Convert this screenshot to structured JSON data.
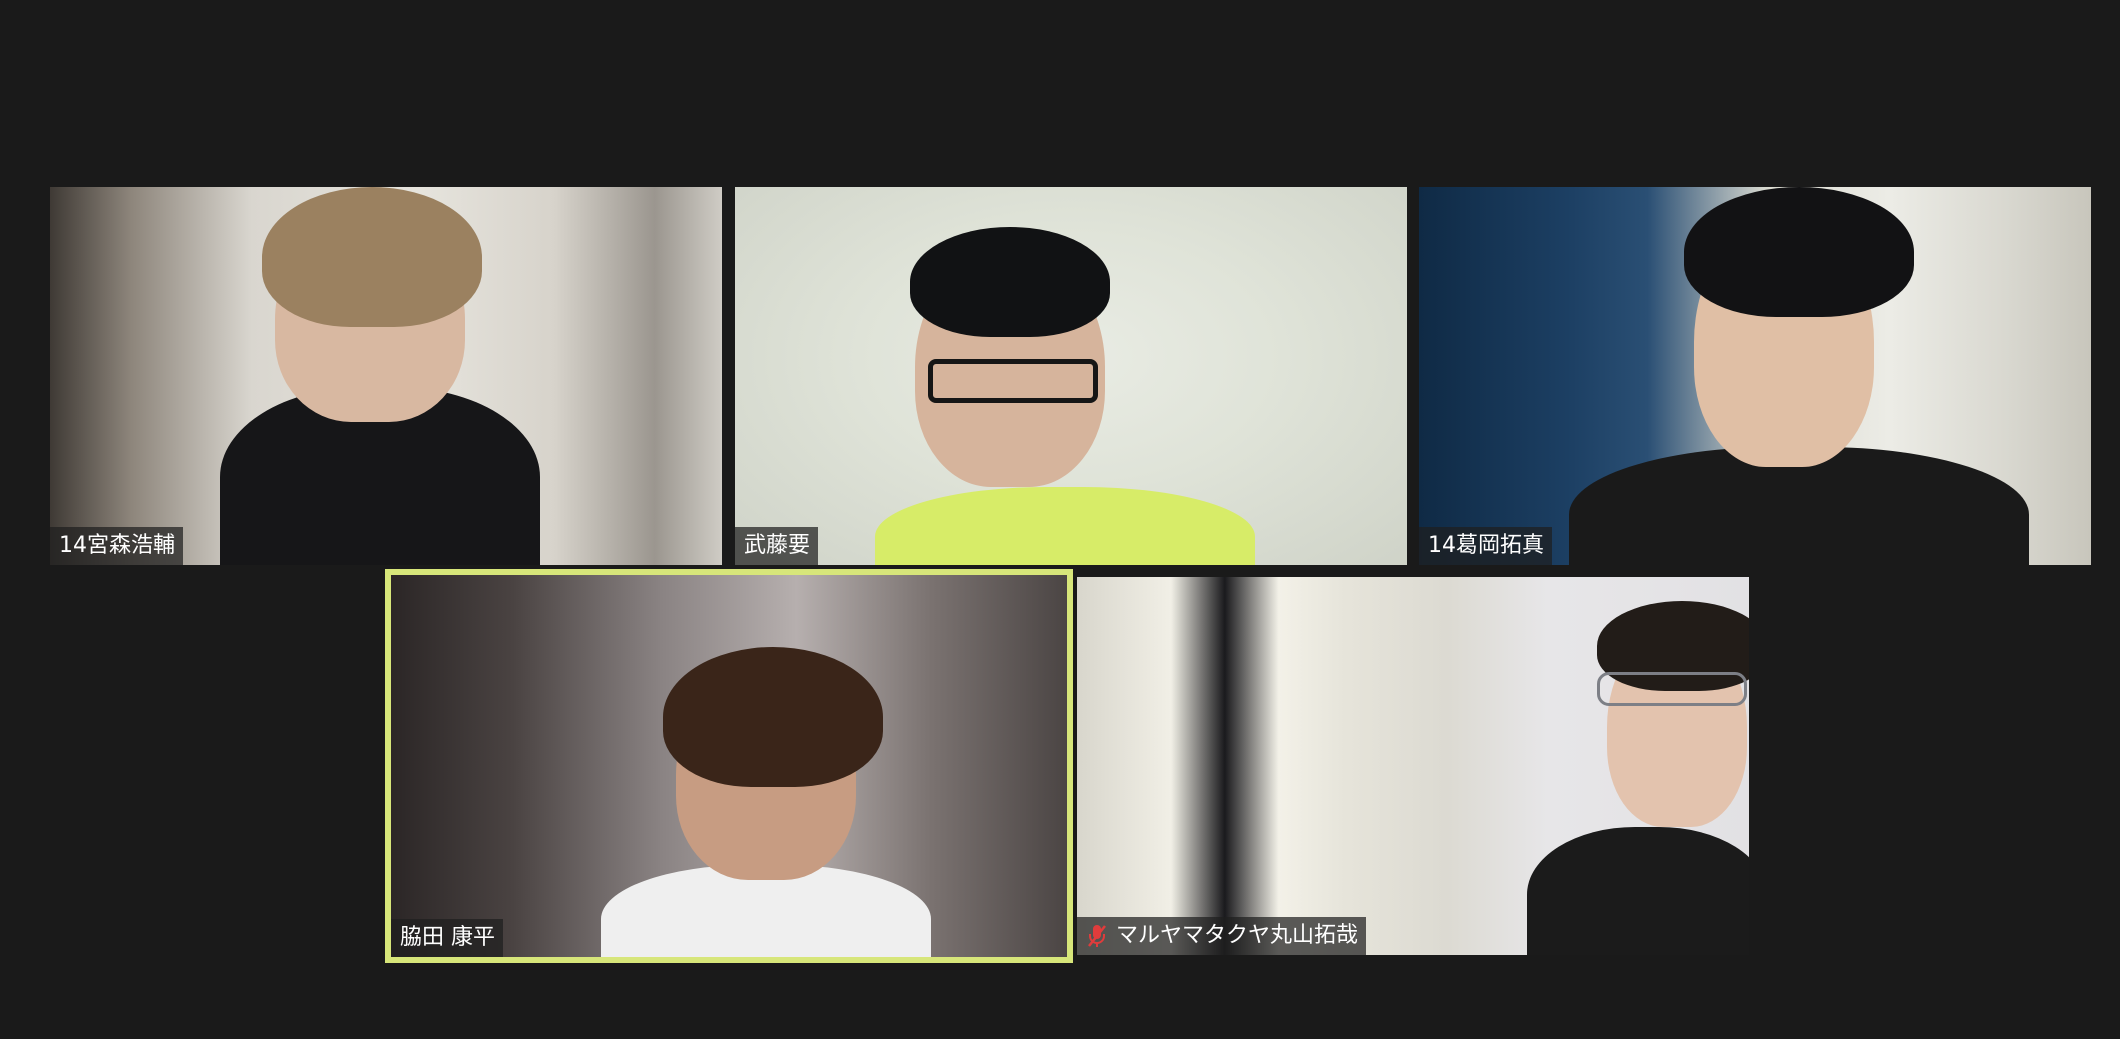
{
  "meeting": {
    "participants": [
      {
        "name": "14宮森浩輔",
        "muted": false,
        "active_speaker": false
      },
      {
        "name": "武藤要",
        "muted": false,
        "active_speaker": false
      },
      {
        "name": "14葛岡拓真",
        "muted": false,
        "active_speaker": false
      },
      {
        "name": "脇田 康平",
        "muted": false,
        "active_speaker": true
      },
      {
        "name": "マルヤマタクヤ丸山拓哉",
        "muted": true,
        "active_speaker": false
      }
    ]
  },
  "colors": {
    "background": "#1a1a1a",
    "active_speaker_border": "#d7e67a",
    "muted_icon": "#e03c3c",
    "nametag_text": "#ffffff"
  },
  "icons": {
    "muted": "mic-muted-icon"
  }
}
